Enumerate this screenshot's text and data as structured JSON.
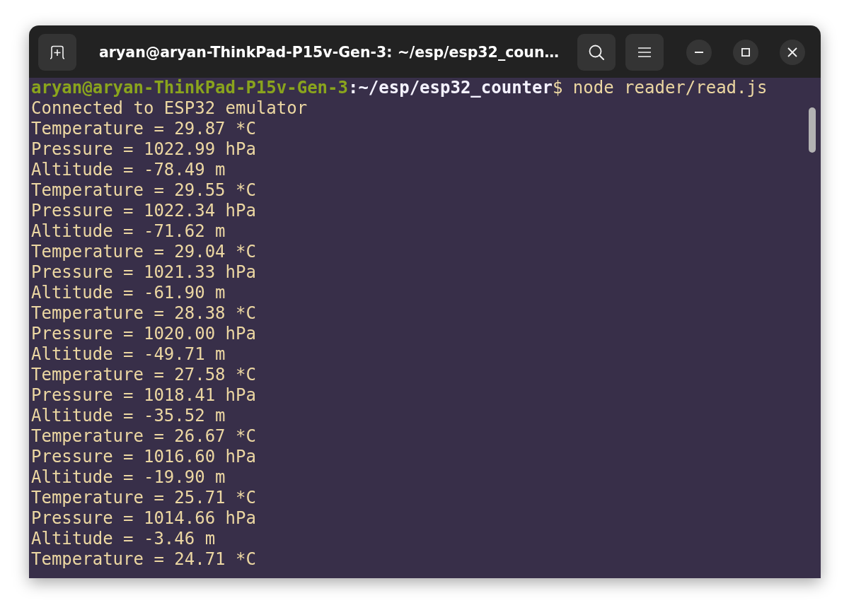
{
  "window": {
    "title": "aryan@aryan-ThinkPad-P15v-Gen-3: ~/esp/esp32_coun…"
  },
  "terminal": {
    "prompt": {
      "user_host": "aryan@aryan-ThinkPad-P15v-Gen-3",
      "separator": ":",
      "path": "~/esp/esp32_counter",
      "symbol": "$",
      "command": "node reader/read.js"
    },
    "output": [
      "Connected to ESP32 emulator",
      "Temperature = 29.87 *C",
      "Pressure = 1022.99 hPa",
      "Altitude = -78.49 m",
      "Temperature = 29.55 *C",
      "Pressure = 1022.34 hPa",
      "Altitude = -71.62 m",
      "Temperature = 29.04 *C",
      "Pressure = 1021.33 hPa",
      "Altitude = -61.90 m",
      "Temperature = 28.38 *C",
      "Pressure = 1020.00 hPa",
      "Altitude = -49.71 m",
      "Temperature = 27.58 *C",
      "Pressure = 1018.41 hPa",
      "Altitude = -35.52 m",
      "Temperature = 26.67 *C",
      "Pressure = 1016.60 hPa",
      "Altitude = -19.90 m",
      "Temperature = 25.71 *C",
      "Pressure = 1014.66 hPa",
      "Altitude = -3.46 m",
      "Temperature = 24.71 *C"
    ]
  }
}
